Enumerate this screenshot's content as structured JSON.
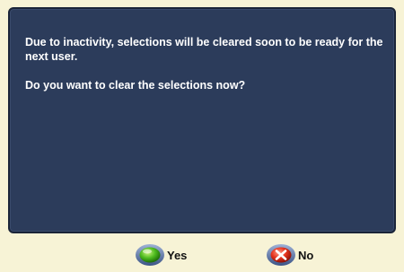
{
  "dialog": {
    "message_line1": "Due to inactivity, selections will be cleared soon to be ready for the next user.",
    "message_line2": "Do you want to clear the selections now?"
  },
  "buttons": {
    "yes_label": "Yes",
    "no_label": "No",
    "yes_icon": "green-circle-icon",
    "no_icon": "red-x-icon"
  },
  "colors": {
    "panel_bg": "#2c3c5b",
    "page_bg": "#f7f3d6",
    "text": "#ffffff"
  }
}
